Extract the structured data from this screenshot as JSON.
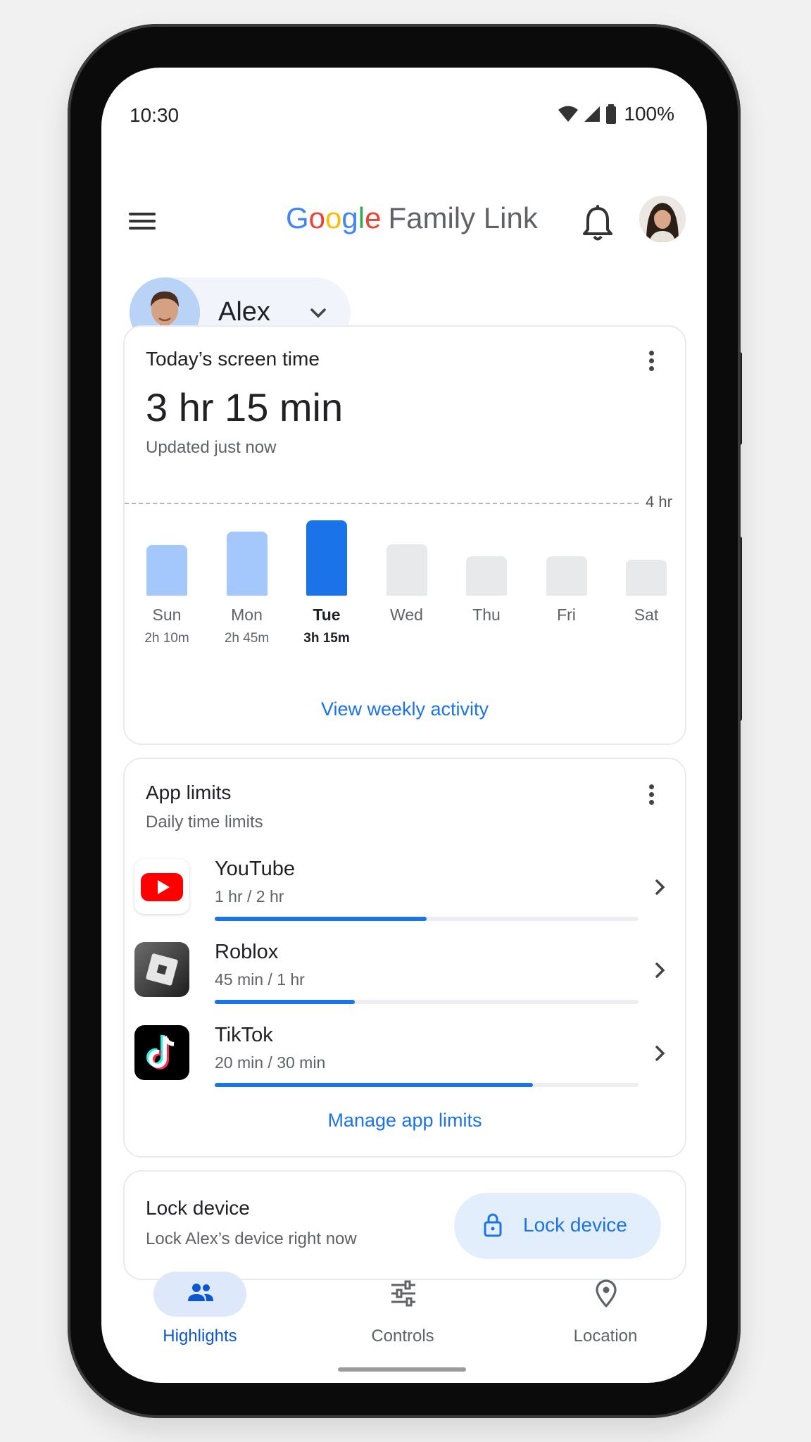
{
  "status_bar": {
    "time": "10:30",
    "battery": "100%"
  },
  "app_bar": {
    "brand_letters": [
      "G",
      "o",
      "o",
      "g",
      "l",
      "e"
    ],
    "brand_suffix": "Family Link"
  },
  "child": {
    "name": "Alex"
  },
  "screen_time": {
    "title": "Today’s screen time",
    "total": "3 hr 15 min",
    "updated": "Updated just now",
    "limit_label": "4 hr",
    "days": [
      {
        "day": "Sun",
        "duration": "2h 10m",
        "hours": 2.17,
        "state": "past"
      },
      {
        "day": "Mon",
        "duration": "2h 45m",
        "hours": 2.75,
        "state": "past"
      },
      {
        "day": "Tue",
        "duration": "3h 15m",
        "hours": 3.25,
        "state": "today"
      },
      {
        "day": "Wed",
        "duration": "",
        "hours": 2.2,
        "state": "future"
      },
      {
        "day": "Thu",
        "duration": "",
        "hours": 1.7,
        "state": "future"
      },
      {
        "day": "Fri",
        "duration": "",
        "hours": 1.7,
        "state": "future"
      },
      {
        "day": "Sat",
        "duration": "",
        "hours": 1.55,
        "state": "future"
      }
    ],
    "link": "View weekly activity"
  },
  "app_limits": {
    "title": "App limits",
    "subtitle": "Daily time limits",
    "apps": [
      {
        "name": "YouTube",
        "usage": "1 hr / 2 hr",
        "progress": 0.5,
        "icon": "youtube-icon"
      },
      {
        "name": "Roblox",
        "usage": "45 min / 1 hr",
        "progress": 0.33,
        "icon": "roblox-icon"
      },
      {
        "name": "TikTok",
        "usage": "20 min / 30 min",
        "progress": 0.75,
        "icon": "tiktok-icon"
      }
    ],
    "link": "Manage app limits"
  },
  "lock_device": {
    "title": "Lock device",
    "subtitle": "Lock Alex’s device right now",
    "button": "Lock device"
  },
  "bottom_nav": [
    {
      "label": "Highlights",
      "icon": "people-icon",
      "selected": true
    },
    {
      "label": "Controls",
      "icon": "sliders-icon",
      "selected": false
    },
    {
      "label": "Location",
      "icon": "location-pin-icon",
      "selected": false
    }
  ],
  "colors": {
    "accent": "#1a73e8",
    "bar_past": "#a4c8fb",
    "bar_today": "#1a73e8",
    "bar_future": "#e8e9eb"
  }
}
